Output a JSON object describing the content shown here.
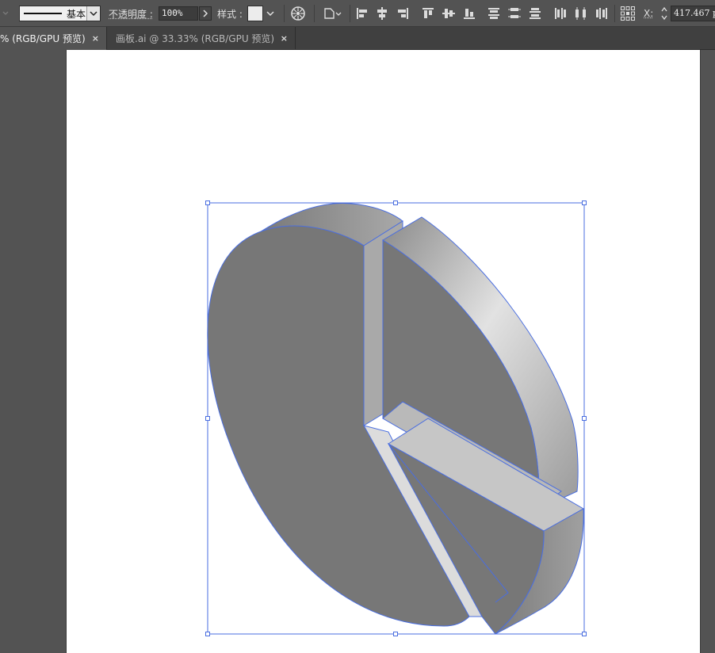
{
  "control_bar": {
    "stroke_profile_label": "基本",
    "opacity_label": "不透明度 :",
    "opacity_value": "100%",
    "style_label": "样式 :",
    "x_label": "X:",
    "x_value": "417.467 p",
    "icons": [
      "recolor-artwork-icon",
      "shape-transform-icon",
      "align-left-icon",
      "align-horizontal-center-icon",
      "align-right-icon",
      "align-top-icon",
      "align-vertical-center-icon",
      "align-bottom-icon",
      "distribute-top-icon",
      "distribute-vertical-center-icon",
      "distribute-bottom-icon",
      "distribute-left-icon",
      "distribute-horizontal-center-icon",
      "distribute-right-icon",
      "reference-point-icon"
    ]
  },
  "tabs": [
    {
      "label": "% (RGB/GPU 预览)",
      "active": true
    },
    {
      "label": "画板.ai @ 33.33% (RGB/GPU 预览)",
      "active": false
    }
  ],
  "tab_close_glyph": "×",
  "colors": {
    "workspace": "#535353",
    "artboard": "#ffffff",
    "selection": "#4a6ee0",
    "pie_face": "#777777",
    "pie_side_light": "#dcdcdc",
    "pie_side_dark": "#8c8c8c"
  }
}
